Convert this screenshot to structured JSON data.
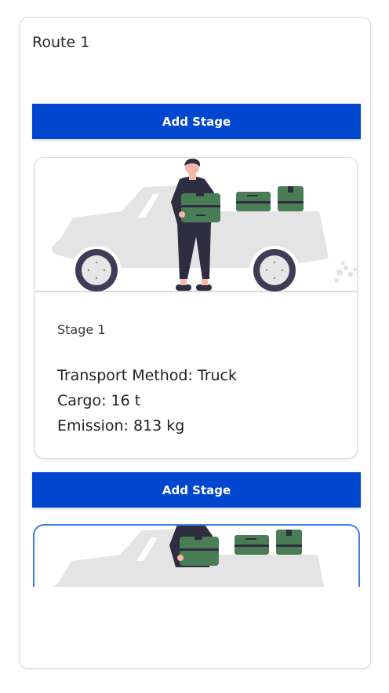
{
  "route": {
    "title": "Route 1"
  },
  "actions": {
    "add_stage_label": "Add Stage"
  },
  "stages": [
    {
      "label": "Stage 1",
      "transport": "Transport Method: Truck",
      "cargo": "Cargo: 16 t",
      "emission": "Emission: 813 kg",
      "illustration": "truck-delivery-illustration"
    },
    {
      "illustration": "truck-delivery-illustration"
    }
  ],
  "colors": {
    "primary": "#0046cf",
    "selected_border": "#3f7fe6",
    "box_green": "#4a7d55",
    "dark_figure": "#2f2e41",
    "truck_gray": "#e4e4e4"
  }
}
